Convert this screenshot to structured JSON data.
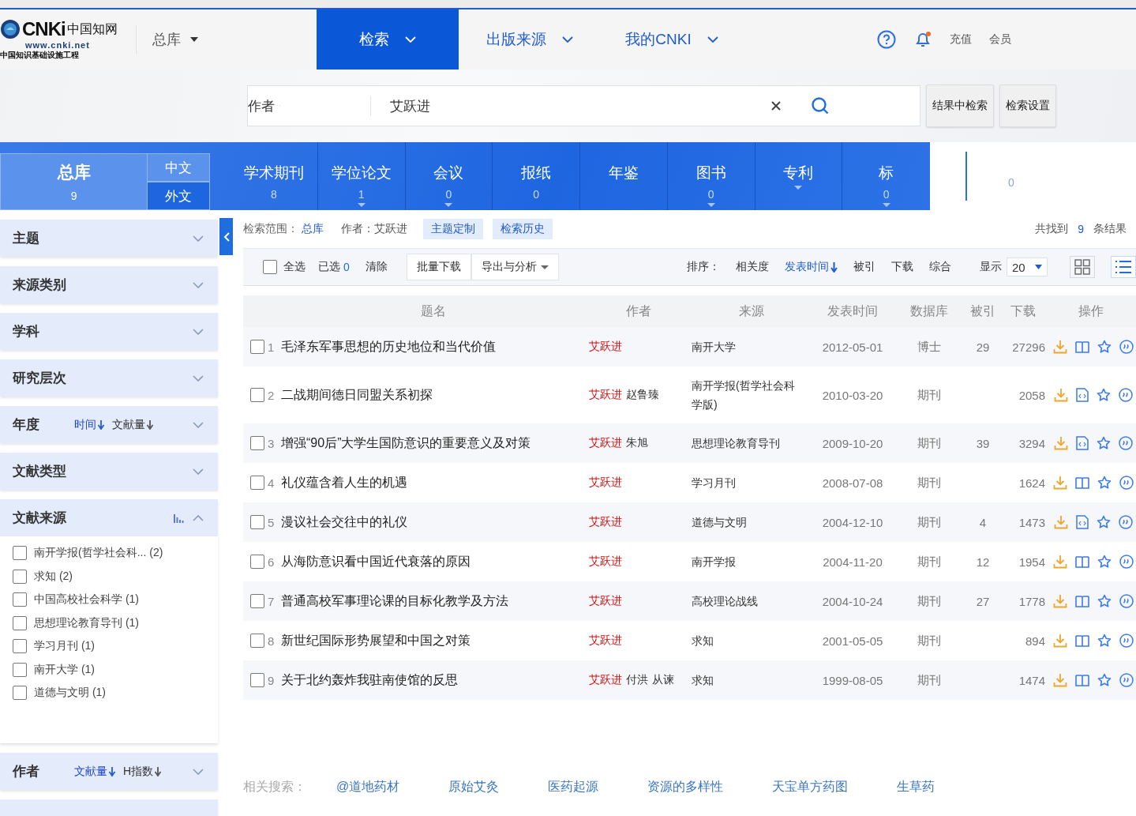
{
  "logo": {
    "mark": "CNKi",
    "name": "中国知网",
    "url": "www.cnki.net",
    "slogan": "中国知识基础设施工程"
  },
  "db_switch": {
    "label": "总库"
  },
  "nav": [
    {
      "label": "检索",
      "selected": true
    },
    {
      "label": "出版来源",
      "selected": false
    },
    {
      "label": "我的CNKI",
      "selected": false
    }
  ],
  "header_links": [
    "充值",
    "会员"
  ],
  "notification_dot": true,
  "search": {
    "field": "作者",
    "value": "艾跃进"
  },
  "search_buttons": [
    "结果中检索",
    "检索设置"
  ],
  "main_tab": {
    "label": "总库",
    "count": "9",
    "selected": true
  },
  "language_tabs": [
    {
      "label": "中文",
      "selected": true
    },
    {
      "label": "外文",
      "selected": false
    }
  ],
  "db_tabs": [
    {
      "label": "学术期刊",
      "count": "8",
      "has_menu": false
    },
    {
      "label": "学位论文",
      "count": "1",
      "has_menu": true
    },
    {
      "label": "会议",
      "count": "0",
      "has_menu": true
    },
    {
      "label": "报纸",
      "count": "0",
      "has_menu": false
    },
    {
      "label": "年鉴",
      "has_menu": false
    },
    {
      "label": "图书",
      "count": "0",
      "has_menu": true
    },
    {
      "label": "专利",
      "has_menu": true
    },
    {
      "label": "标",
      "count": "0",
      "has_menu": true
    }
  ],
  "extra_tab_count": "0",
  "filters": [
    {
      "label": "主题",
      "expanded": false
    },
    {
      "label": "来源类别",
      "expanded": false
    },
    {
      "label": "学科",
      "expanded": false
    },
    {
      "label": "研究层次",
      "expanded": false
    },
    {
      "label": "年度",
      "expanded": false,
      "sorts": [
        {
          "label": "时间",
          "selected": true
        },
        {
          "label": "文献量",
          "selected": false
        }
      ]
    },
    {
      "label": "文献类型",
      "expanded": false
    },
    {
      "label": "文献来源",
      "expanded": true,
      "chart": true,
      "items": [
        {
          "label": "南开学报(哲学社会科... (2)",
          "checked": false
        },
        {
          "label": "求知 (2)",
          "checked": false
        },
        {
          "label": "中国高校社会科学 (1)",
          "checked": false
        },
        {
          "label": "思想理论教育导刊 (1)",
          "checked": false
        },
        {
          "label": "学习月刊 (1)",
          "checked": false
        },
        {
          "label": "南开大学 (1)",
          "checked": false
        },
        {
          "label": "道德与文明 (1)",
          "checked": false
        }
      ]
    },
    {
      "label": "作者",
      "expanded": false,
      "sorts": [
        {
          "label": "文献量",
          "selected": true
        },
        {
          "label": "H指数",
          "selected": false
        }
      ]
    }
  ],
  "scope": {
    "label": "检索范围：",
    "db": "总库",
    "condition": "作者：艾跃进",
    "buttons": [
      "主题定制",
      "检索历史"
    ],
    "found_prefix": "共找到",
    "found_count": "9",
    "found_suffix": "条结果"
  },
  "toolbar": {
    "select_all": {
      "label": "全选",
      "checked": false
    },
    "selected_label": "已选",
    "selected_count": "0",
    "clear": "清除",
    "batch_download": "批量下载",
    "export": "导出与分析"
  },
  "sort": {
    "label": "排序：",
    "options": [
      {
        "label": "相关度",
        "selected": false
      },
      {
        "label": "发表时间",
        "selected": true
      },
      {
        "label": "被引",
        "selected": false
      },
      {
        "label": "下载",
        "selected": false
      },
      {
        "label": "综合",
        "selected": false
      }
    ]
  },
  "page_size": {
    "label": "显示",
    "value": "20"
  },
  "views": [
    {
      "kind": "grid",
      "selected": false
    },
    {
      "kind": "list",
      "selected": true
    }
  ],
  "table": {
    "columns": [
      "题名",
      "作者",
      "来源",
      "发表时间",
      "数据库",
      "被引",
      "下载",
      "操作"
    ],
    "rows": [
      {
        "no": "1",
        "checked": false,
        "title": "毛泽东军事思想的历史地位和当代价值",
        "authors": [
          {
            "name": "艾跃进",
            "highlighted": true
          }
        ],
        "source": "南开大学",
        "date": "2012-05-01",
        "db": "博士",
        "cited": "29",
        "downloads": "27296",
        "kind": "book"
      },
      {
        "no": "2",
        "checked": false,
        "title": "二战期间德日同盟关系初探",
        "authors": [
          {
            "name": "艾跃进",
            "highlighted": true
          },
          {
            "name": "赵鲁臻",
            "highlighted": false
          }
        ],
        "source": "南开学报(哲学社会科学版)",
        "date": "2010-03-20",
        "db": "期刊",
        "downloads": "2058",
        "kind": "html"
      },
      {
        "no": "3",
        "checked": false,
        "title": "增强“90后”大学生国防意识的重要意义及对策",
        "authors": [
          {
            "name": "艾跃进",
            "highlighted": true
          },
          {
            "name": "朱旭",
            "highlighted": false
          }
        ],
        "source": "思想理论教育导刊",
        "date": "2009-10-20",
        "db": "期刊",
        "cited": "39",
        "downloads": "3294",
        "kind": "html"
      },
      {
        "no": "4",
        "checked": false,
        "title": "礼仪蕴含着人生的机遇",
        "authors": [
          {
            "name": "艾跃进",
            "highlighted": true
          }
        ],
        "source": "学习月刊",
        "date": "2008-07-08",
        "db": "期刊",
        "downloads": "1624",
        "kind": "book"
      },
      {
        "no": "5",
        "checked": false,
        "title": "漫议社会交往中的礼仪",
        "authors": [
          {
            "name": "艾跃进",
            "highlighted": true
          }
        ],
        "source": "道德与文明",
        "date": "2004-12-10",
        "db": "期刊",
        "cited": "4",
        "downloads": "1473",
        "kind": "html"
      },
      {
        "no": "6",
        "checked": false,
        "title": "从海防意识看中国近代衰落的原因",
        "authors": [
          {
            "name": "艾跃进",
            "highlighted": true
          }
        ],
        "source": "南开学报",
        "date": "2004-11-20",
        "db": "期刊",
        "cited": "12",
        "downloads": "1954",
        "kind": "book"
      },
      {
        "no": "7",
        "checked": false,
        "title": "普通高校军事理论课的目标化教学及方法",
        "authors": [
          {
            "name": "艾跃进",
            "highlighted": true
          }
        ],
        "source": "高校理论战线",
        "date": "2004-10-24",
        "db": "期刊",
        "cited": "27",
        "downloads": "1778",
        "kind": "book"
      },
      {
        "no": "8",
        "checked": false,
        "title": "新世纪国际形势展望和中国之对策",
        "authors": [
          {
            "name": "艾跃进",
            "highlighted": true
          }
        ],
        "source": "求知",
        "date": "2001-05-05",
        "db": "期刊",
        "downloads": "894",
        "kind": "book"
      },
      {
        "no": "9",
        "checked": false,
        "title": "关于北约轰炸我驻南使馆的反思",
        "authors": [
          {
            "name": "艾跃进",
            "highlighted": true
          },
          {
            "name": "付洪",
            "highlighted": false
          },
          {
            "name": "从谏",
            "highlighted": false
          }
        ],
        "source": "求知",
        "date": "1999-08-05",
        "db": "期刊",
        "downloads": "1474",
        "kind": "book"
      }
    ]
  },
  "related": {
    "label": "相关搜索：",
    "items": [
      "@道地药材",
      "原始艾灸",
      "医药起源",
      "资源的多样性",
      "天宝单方药图",
      "生草药"
    ]
  }
}
